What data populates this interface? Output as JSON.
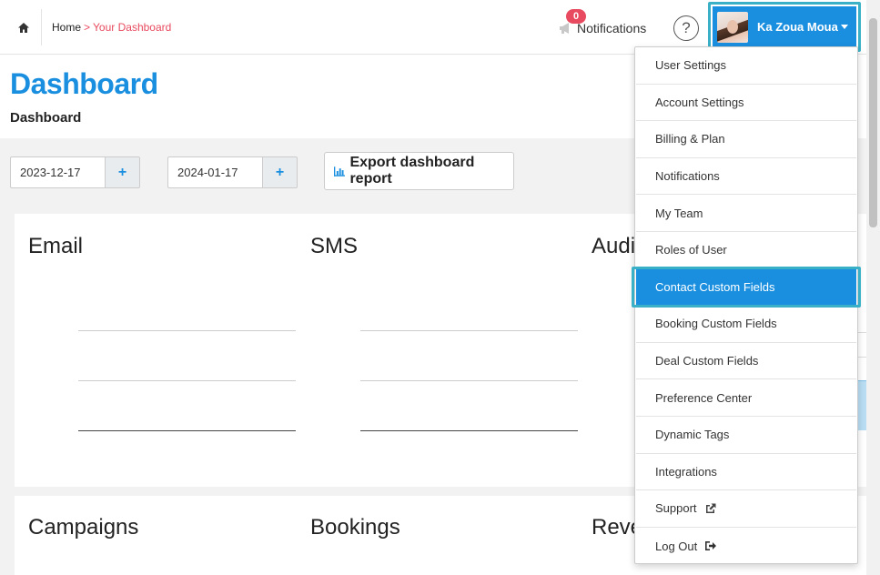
{
  "header": {
    "breadcrumb": {
      "home": "Home",
      "separator": ">",
      "current": "Your Dashboard"
    },
    "notifications": {
      "count": "0",
      "label": "Notifications"
    },
    "help_label": "?",
    "user": {
      "name": "Ka Zoua Moua"
    }
  },
  "page": {
    "title": "Dashboard",
    "subtitle": "Dashboard"
  },
  "filters": {
    "start_date": "2023-12-17",
    "end_date": "2024-01-17",
    "add_label": "+",
    "export_label": "Export dashboard report"
  },
  "panels": {
    "row1": [
      "Email",
      "SMS",
      "Audi"
    ],
    "row2": [
      "Campaigns",
      "Bookings",
      "Reve"
    ]
  },
  "user_menu": {
    "items": [
      "User Settings",
      "Account Settings",
      "Billing & Plan",
      "Notifications",
      "My Team",
      "Roles of User",
      "Contact Custom Fields",
      "Booking Custom Fields",
      "Deal Custom Fields",
      "Preference Center",
      "Dynamic Tags",
      "Integrations",
      "Support",
      "Log Out"
    ],
    "active_item": "Contact Custom Fields"
  },
  "colors": {
    "accent": "#1a8fdf",
    "highlight": "#3ab0c7",
    "badge": "#e84a5f"
  },
  "icons": [
    "home-icon",
    "megaphone-icon",
    "help-icon",
    "caret-down-icon",
    "bar-chart-icon",
    "external-link-icon",
    "logout-icon",
    "plus-icon"
  ]
}
